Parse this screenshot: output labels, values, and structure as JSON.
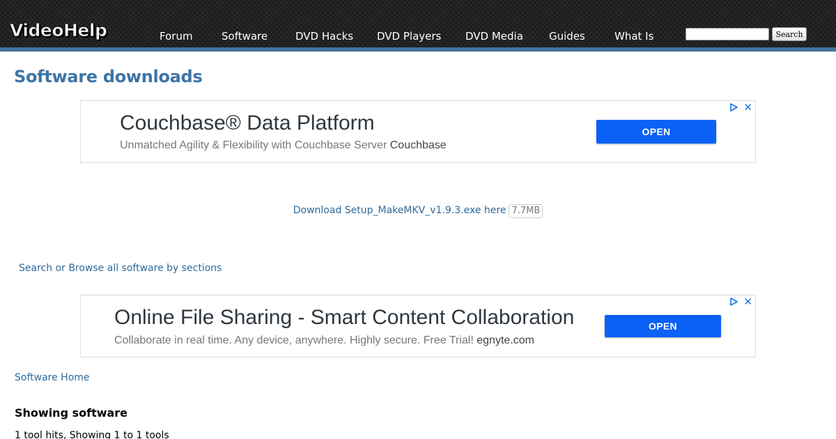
{
  "header": {
    "logo": "VideoHelp",
    "nav": [
      "Forum",
      "Software",
      "DVD Hacks",
      "DVD Players",
      "DVD Media",
      "Guides",
      "What Is"
    ],
    "search": {
      "value": "",
      "button_label": "Search"
    }
  },
  "main": {
    "title": "Software downloads",
    "download": {
      "link_text": "Download Setup_MakeMKV_v1.9.3.exe here",
      "size": "7.7MB"
    },
    "browse_link": "Search or Browse all software by sections",
    "home_link": "Software Home",
    "section_heading": "Showing software",
    "hits_text": "1 tool hits, Showing 1 to 1 tools"
  },
  "ads": [
    {
      "headline": "Couchbase® Data Platform",
      "subtext": "Unmatched Agility & Flexibility with Couchbase Server",
      "sponsor": "Couchbase",
      "button_label": "OPEN"
    },
    {
      "headline": "Online File Sharing - Smart Content Collaboration",
      "subtext": "Collaborate in real time. Any device, anywhere. Highly secure. Free Trial!",
      "sponsor": "egnyte.com",
      "button_label": "OPEN"
    }
  ],
  "colors": {
    "header_bg": "#222222",
    "header_bar": "#41729f",
    "title": "#3d75a6",
    "link": "#2f6a9a",
    "ad_button": "#0a61f5"
  },
  "icons": {
    "ad_choices": "adchoices-icon",
    "ad_close": "close-icon"
  }
}
